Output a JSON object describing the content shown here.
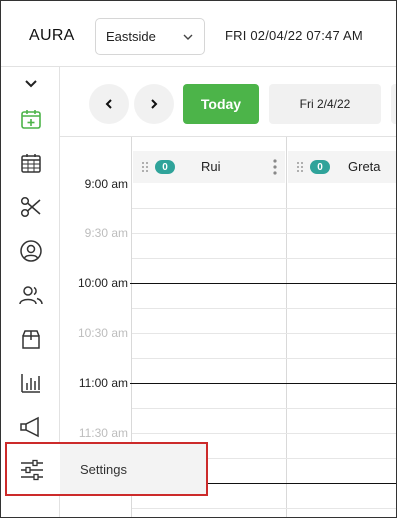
{
  "header": {
    "brand": "AURA",
    "location": "Eastside",
    "datetime": "FRI 02/04/22   07:47 AM"
  },
  "toolbar": {
    "today_label": "Today",
    "date_label": "Fri 2/4/22"
  },
  "sidebar": {
    "items": [
      {
        "icon": "calendar-add-icon"
      },
      {
        "icon": "calendar-grid-icon"
      },
      {
        "icon": "scissors-icon"
      },
      {
        "icon": "user-circle-icon"
      },
      {
        "icon": "users-icon"
      },
      {
        "icon": "box-icon"
      },
      {
        "icon": "bar-chart-icon"
      },
      {
        "icon": "megaphone-icon"
      },
      {
        "icon": "sliders-icon"
      }
    ],
    "settings_label": "Settings"
  },
  "calendar": {
    "times": [
      {
        "label": "9:00 am",
        "type": "hour"
      },
      {
        "label": "9:30 am",
        "type": "half"
      },
      {
        "label": "10:00 am",
        "type": "hour"
      },
      {
        "label": "10:30 am",
        "type": "half"
      },
      {
        "label": "11:00 am",
        "type": "hour"
      },
      {
        "label": "11:30 am",
        "type": "half"
      }
    ],
    "staff": [
      {
        "name": "Rui",
        "count": "0"
      },
      {
        "name": "Greta",
        "count": "0"
      }
    ]
  },
  "colors": {
    "accent_green": "#4cb449",
    "badge_teal": "#2fa39a",
    "highlight_red": "#cc2a2a"
  }
}
